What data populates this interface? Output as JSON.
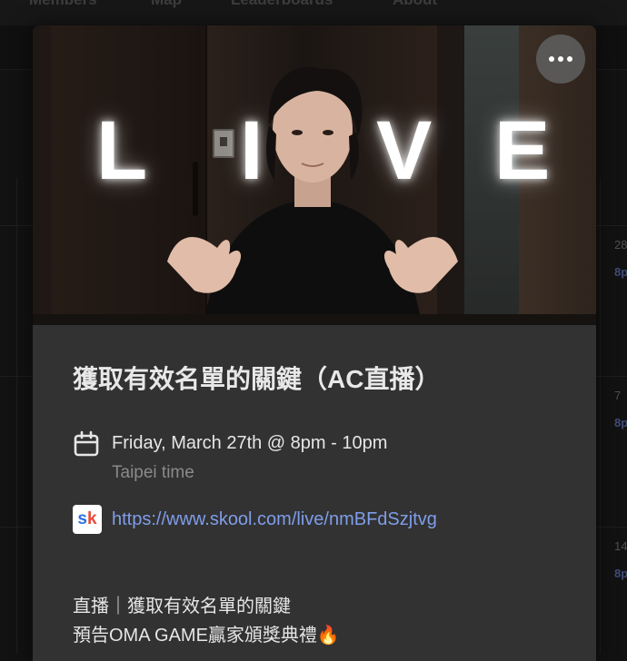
{
  "background_nav": {
    "items": [
      "Members",
      "Map",
      "Leaderboards",
      "About"
    ]
  },
  "background_calendar": {
    "day_numbers": [
      "28",
      "7",
      "14"
    ],
    "time_labels": [
      "8p",
      "8p",
      "8p"
    ]
  },
  "cover": {
    "neon_text": [
      "L",
      "I",
      "V",
      "E"
    ]
  },
  "event": {
    "title": "獲取有效名單的關鍵（AC直播）",
    "date": "Friday, March 27th @ 8pm - 10pm",
    "timezone": "Taipei time",
    "link": "https://www.skool.com/live/nmBFdSzjtvg",
    "link_icon": {
      "s": "s",
      "k": "k"
    },
    "description": [
      "直播｜獲取有效名單的關鍵",
      "預告OMA GAME贏家頒獎典禮🔥"
    ]
  },
  "colors": {
    "modal_bg": "#323232",
    "link": "#7f9dea",
    "page_bg": "#121212"
  }
}
